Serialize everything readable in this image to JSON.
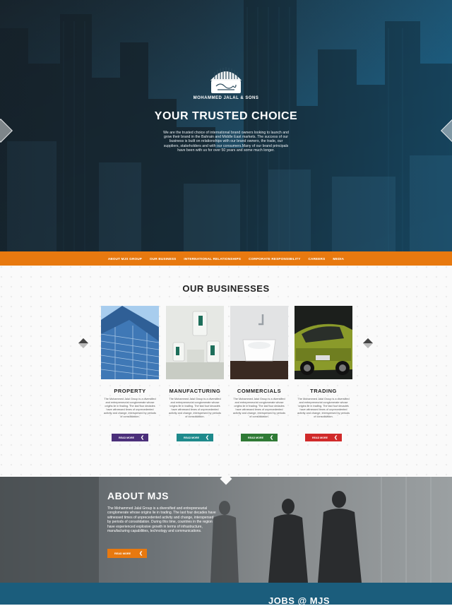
{
  "hero": {
    "brand": "MOHAMMED JALAL & SONS",
    "title": "YOUR TRUSTED CHOICE",
    "text": "We are the trusted choice of international brand owners looking to launch and grow their brand in the Bahrain and Middle East markets. The success of our business is built on relationships with our brand owners, the trade, our suppliers, stakeholders and with our consumers.Many of our brand principals have been with us for over 50 years and some much longer."
  },
  "nav": {
    "items": [
      {
        "label": "ABOUT MJS GROUP"
      },
      {
        "label": "OUR BUSINESS"
      },
      {
        "label": "INTERNATIONAL RELATIONSHIPS"
      },
      {
        "label": "CORPORATE RESPONSIBILITY"
      },
      {
        "label": "CAREERS"
      },
      {
        "label": "MEDIA"
      }
    ]
  },
  "businesses": {
    "title": "OUR BUSINESSES",
    "cards": [
      {
        "title": "PROPERTY",
        "text": "The Mohammed Jalal Group is a diversified and entrepreneurial conglomerate whose origins lie in trading. The last four decades have witnessed times of unprecedented activity and change, interspersed by periods of consolidation.",
        "button": "READ MORE",
        "color": "#4b2f7a"
      },
      {
        "title": "MANUFACTURING",
        "text": "The Mohammed Jalal Group is a diversified and entrepreneurial conglomerate whose origins lie in trading. The last four decades have witnessed times of unprecedented activity and change, interspersed by periods of consolidation.",
        "button": "READ MORE",
        "color": "#1e8a8c"
      },
      {
        "title": "COMMERCIALS",
        "text": "The Mohammed Jalal Group is a diversified and entrepreneurial conglomerate whose origins lie in trading. The last four decades have witnessed times of unprecedented activity and change, interspersed by periods of consolidation.",
        "button": "READ MORE",
        "color": "#2f7a35"
      },
      {
        "title": "TRADING",
        "text": "The Mohammed Jalal Group is a diversified and entrepreneurial conglomerate whose origins lie in trading. The last four decades have witnessed times of unprecedented activity and change, interspersed by periods of consolidation.",
        "button": "READ MORE",
        "color": "#d02a2a"
      }
    ]
  },
  "about": {
    "title": "ABOUT MJS",
    "text": "The Mohammed Jalal Group is a diversified and entrepreneurial conglomerate whose origins lie in trading. The last four decades have witnessed times of unprecedented activity and change, interspersed by periods of consolidation. During this time, countries in the region have experienced explosive growth in terms of infrastructure, manufacturing capabilities, technology and communications.",
    "button": "READ MORE"
  },
  "jobs": {
    "title": "JOBS @ MJS"
  },
  "colors": {
    "accent": "#e8790f",
    "hero_blue": "#1c78a6",
    "jobs_blue": "#1b5d7c"
  }
}
